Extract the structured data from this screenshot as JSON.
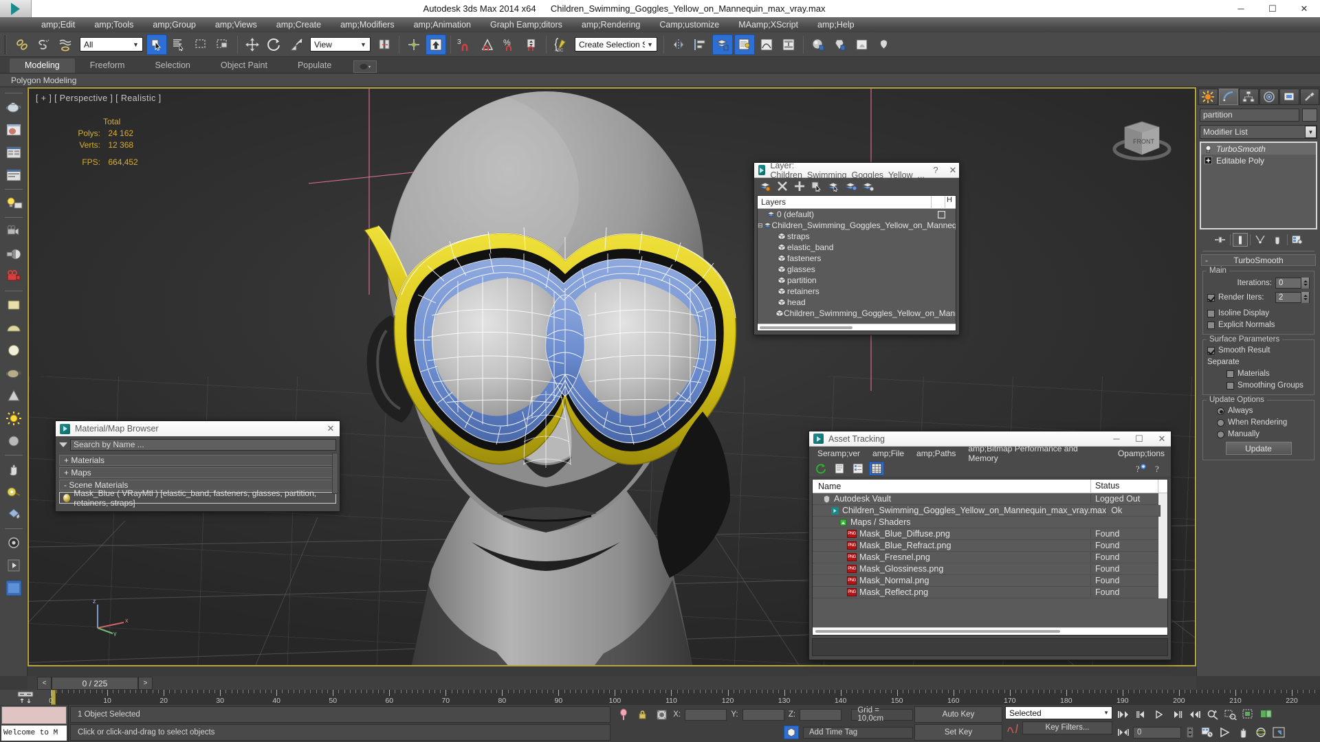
{
  "window": {
    "app_title": "Autodesk 3ds Max  2014 x64",
    "file_name": "Children_Swimming_Goggles_Yellow_on_Mannequin_max_vray.max",
    "minimize": "─",
    "maximize": "☐",
    "close": "✕"
  },
  "menubar": {
    "items": [
      {
        "label": "amp;Edit"
      },
      {
        "label": "amp;Tools"
      },
      {
        "label": "amp;Group"
      },
      {
        "label": "amp;Views"
      },
      {
        "label": "amp;Create"
      },
      {
        "label": "amp;Modifiers"
      },
      {
        "label": "amp;Animation"
      },
      {
        "label": "Graph Eamp;ditors"
      },
      {
        "label": "amp;Rendering"
      },
      {
        "label": "Camp;ustomize"
      },
      {
        "label": "MAamp;XScript"
      },
      {
        "label": "amp;Help"
      }
    ]
  },
  "toolbar": {
    "selection_filter": "All",
    "reference_coord": "View",
    "named_selection_sets": "Create Selection Se",
    "snap_percent_label": "%",
    "snap_3_label": "3"
  },
  "ribbon": {
    "tabs": [
      {
        "label": "Modeling",
        "selected": true
      },
      {
        "label": "Freeform",
        "selected": false
      },
      {
        "label": "Selection",
        "selected": false
      },
      {
        "label": "Object Paint",
        "selected": false
      },
      {
        "label": "Populate",
        "selected": false
      }
    ],
    "subtitle": "Polygon Modeling"
  },
  "viewport": {
    "label": "[ + ] [ Perspective ] [ Realistic ]",
    "stats": {
      "header": "Total",
      "polys_label": "Polys:",
      "polys_value": "24 162",
      "verts_label": "Verts:",
      "verts_value": "12 368",
      "fps_label": "FPS:",
      "fps_value": "664,452"
    },
    "navcube_face": "FRONT",
    "axis_z": "z",
    "axis_x": "x",
    "axis_y": "y"
  },
  "command_panel": {
    "tabs": [
      {
        "name": "create-tab",
        "selected": false
      },
      {
        "name": "modify-tab",
        "selected": true
      },
      {
        "name": "hierarchy-tab",
        "selected": false
      },
      {
        "name": "motion-tab",
        "selected": false
      },
      {
        "name": "display-tab",
        "selected": false
      },
      {
        "name": "utilities-tab",
        "selected": false
      }
    ],
    "object_name": "partition",
    "modifier_list_label": "Modifier List",
    "stack": [
      {
        "label": "TurboSmooth",
        "italic": true,
        "selected": true
      },
      {
        "label": "Editable Poly",
        "italic": false,
        "selected": false
      }
    ],
    "rollout": {
      "title": "TurboSmooth",
      "main_group": "Main",
      "iterations_label": "Iterations:",
      "iterations_value": "0",
      "render_iters_label": "Render Iters:",
      "render_iters_value": "2",
      "render_iters_checked": true,
      "isoline_label": "Isoline Display",
      "isoline_checked": false,
      "explicit_normals_label": "Explicit Normals",
      "explicit_normals_checked": false,
      "surface_group": "Surface Parameters",
      "smooth_result_label": "Smooth Result",
      "smooth_result_checked": true,
      "separate_label": "Separate",
      "materials_label": "Materials",
      "materials_checked": false,
      "smoothing_groups_label": "Smoothing Groups",
      "smoothing_groups_checked": false,
      "update_group": "Update Options",
      "always_label": "Always",
      "when_rendering_label": "When Rendering",
      "manually_label": "Manually",
      "update_button": "Update",
      "update_mode": "Always"
    }
  },
  "layer_dialog": {
    "title": "Layer: Children_Swimming_Goggles_Yellow_...",
    "help": "?",
    "close": "✕",
    "column_name": "Layers",
    "column_hide": "H",
    "rows": [
      {
        "label": "0 (default)",
        "indent": 0,
        "type": "layer",
        "expand": "",
        "mark": "box"
      },
      {
        "label": "Children_Swimming_Goggles_Yellow_on_Mannequin",
        "indent": 0,
        "type": "layer",
        "expand": "⊟",
        "mark": "check"
      },
      {
        "label": "straps",
        "indent": 1,
        "type": "object",
        "expand": "",
        "mark": ""
      },
      {
        "label": "elastic_band",
        "indent": 1,
        "type": "object",
        "expand": "",
        "mark": ""
      },
      {
        "label": "fasteners",
        "indent": 1,
        "type": "object",
        "expand": "",
        "mark": ""
      },
      {
        "label": "glasses",
        "indent": 1,
        "type": "object",
        "expand": "",
        "mark": ""
      },
      {
        "label": "partition",
        "indent": 1,
        "type": "object",
        "expand": "",
        "mark": ""
      },
      {
        "label": "retainers",
        "indent": 1,
        "type": "object",
        "expand": "",
        "mark": ""
      },
      {
        "label": "head",
        "indent": 1,
        "type": "object",
        "expand": "",
        "mark": ""
      },
      {
        "label": "Children_Swimming_Goggles_Yellow_on_Mannequin",
        "indent": 1,
        "type": "object",
        "expand": "",
        "mark": ""
      }
    ]
  },
  "asset_dialog": {
    "title": "Asset Tracking",
    "minimize": "─",
    "maximize": "☐",
    "close": "✕",
    "menu": [
      {
        "label": "Seramp;ver"
      },
      {
        "label": "amp;File"
      },
      {
        "label": "amp;Paths"
      },
      {
        "label": "amp;Bitmap Performance and Memory"
      },
      {
        "label": "Opamp;tions"
      }
    ],
    "column_name": "Name",
    "column_status": "Status",
    "rows": [
      {
        "name": "Autodesk Vault",
        "status": "Logged Out",
        "indent": 0,
        "icon": "vault"
      },
      {
        "name": "Children_Swimming_Goggles_Yellow_on_Mannequin_max_vray.max",
        "status": "Ok",
        "indent": 1,
        "icon": "max"
      },
      {
        "name": "Maps / Shaders",
        "status": "",
        "indent": 2,
        "icon": "maps"
      },
      {
        "name": "Mask_Blue_Diffuse.png",
        "status": "Found",
        "indent": 3,
        "icon": "png"
      },
      {
        "name": "Mask_Blue_Refract.png",
        "status": "Found",
        "indent": 3,
        "icon": "png"
      },
      {
        "name": "Mask_Fresnel.png",
        "status": "Found",
        "indent": 3,
        "icon": "png"
      },
      {
        "name": "Mask_Glossiness.png",
        "status": "Found",
        "indent": 3,
        "icon": "png"
      },
      {
        "name": "Mask_Normal.png",
        "status": "Found",
        "indent": 3,
        "icon": "png"
      },
      {
        "name": "Mask_Reflect.png",
        "status": "Found",
        "indent": 3,
        "icon": "png"
      }
    ]
  },
  "material_browser": {
    "title": "Material/Map Browser",
    "close": "✕",
    "search_placeholder": "Search by Name ...",
    "groups": [
      {
        "label": "+ Materials"
      },
      {
        "label": "+ Maps"
      },
      {
        "label": "-  Scene Materials"
      }
    ],
    "entry": "Mask_Blue  ( VRayMtl ) [elastic_band, fasteners, glasses, partition, retainers, straps]"
  },
  "timeline": {
    "prev": "<",
    "next": ">",
    "current_frame": "0 / 225",
    "ruler_labels": [
      "0",
      "10",
      "20",
      "30",
      "40",
      "50",
      "60",
      "70",
      "80",
      "90",
      "100",
      "110",
      "120",
      "130",
      "140",
      "150",
      "160",
      "170",
      "180",
      "190",
      "200",
      "210",
      "220"
    ]
  },
  "statusbar": {
    "listener_text": "Welcome to M",
    "selection_status": "1 Object Selected",
    "prompt": "Click or click-and-drag to select objects",
    "x_label": "X:",
    "y_label": "Y:",
    "z_label": "Z:",
    "x_value": "",
    "y_value": "",
    "z_value": "",
    "grid_text": "Grid = 10,0cm",
    "add_time_tag": "Add Time Tag",
    "auto_key": "Auto Key",
    "set_key": "Set Key",
    "key_mode": "Selected",
    "key_filters": "Key Filters...",
    "frame_value": "0"
  },
  "colors": {
    "accent_blue": "#2d6fd4",
    "viewport_border": "#b5a642",
    "goggle_yellow": "#d9c618",
    "goggle_blue": "#6f8fd0",
    "panel_bg": "#4a4a4a",
    "helper_pink": "#e0709d"
  }
}
